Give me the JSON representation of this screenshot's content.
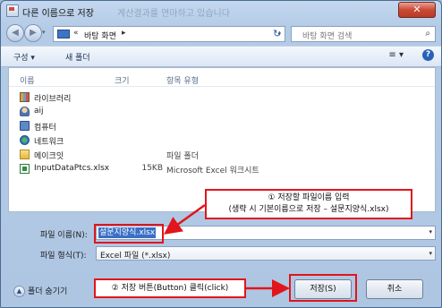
{
  "window": {
    "title": "다른 이름으로 저장",
    "background_text": "계산결과를 연마하고 있습니다",
    "close_glyph": "✕"
  },
  "address_bar": {
    "back_glyph": "◀",
    "forward_glyph": "▶",
    "dropdown_glyph": "▾",
    "breadcrumb": "바탕 화면",
    "breadcrumb_arrow": "▸",
    "sep": "«",
    "refresh_glyph": "↻",
    "search_placeholder": "바탕 화면 검색",
    "search_icon": "search-icon"
  },
  "toolbar": {
    "organize_label": "구성 ▾",
    "new_folder_label": "새 폴더",
    "view_glyph": "≡ ▾",
    "help_glyph": "?"
  },
  "file_list": {
    "columns": [
      "이름",
      "크기",
      "항목 유형"
    ],
    "items": [
      {
        "name": "라이브러리",
        "size": "",
        "type": "",
        "icon": "library-icon"
      },
      {
        "name": "aij",
        "size": "",
        "type": "",
        "icon": "user-icon"
      },
      {
        "name": "컴퓨터",
        "size": "",
        "type": "",
        "icon": "computer-icon"
      },
      {
        "name": "네트워크",
        "size": "",
        "type": "",
        "icon": "network-icon"
      },
      {
        "name": "메이크잇",
        "size": "",
        "type": "파일 폴더",
        "icon": "folder-icon"
      },
      {
        "name": "InputDataPtcs.xlsx",
        "size": "15KB",
        "type": "Microsoft Excel 워크시트",
        "icon": "excel-file-icon"
      }
    ]
  },
  "form": {
    "filename_label": "파일 이름(N):",
    "filename_value": "설문지양식.xlsx",
    "filetype_label": "파일 형식(T):",
    "filetype_value": "Excel 파일 (*.xlsx)",
    "dropdown_glyph": "▾"
  },
  "annotations": {
    "callout1_line1": "① 저장할 파일이름 입력",
    "callout1_line2": "(생략 시 기본이름으로 저장 – 설문지양식.xlsx)",
    "callout2": "② 저장 버튼(Button) 클릭(click)",
    "color": "#e1151b"
  },
  "footer": {
    "hide_folders_label": "폴더 숨기기",
    "hide_folders_glyph": "▲",
    "save_label": "저장(S)",
    "cancel_label": "취소"
  }
}
